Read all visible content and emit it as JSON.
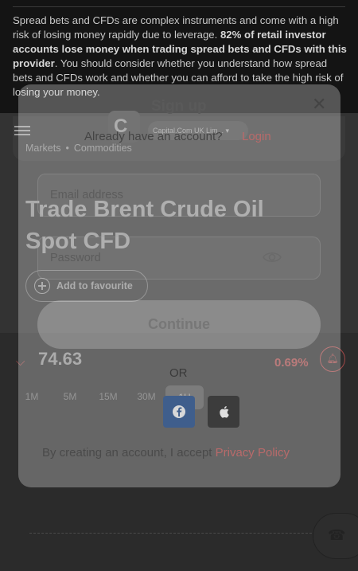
{
  "risk_warning": {
    "text_start": "Spread bets and CFDs are complex instruments and come with a high risk of losing money rapidly due to leverage. ",
    "text_bold": "82% of retail investor accounts lose money when trading spread bets and CFDs with this provider",
    "text_end": ". You should consider whether you understand how spread bets and CFDs work and whether you can afford to take the high risk of losing your money."
  },
  "header": {
    "logo_letter": "C",
    "entity_label": "Capital.Com UK Lim...",
    "icons": {
      "menu": "menu-icon",
      "dropdown": "chevron-down-icon"
    }
  },
  "breadcrumb": [
    "Markets",
    "Commodities"
  ],
  "instrument": {
    "title": "Trade Brent Crude Oil Spot CFD",
    "favourite_label": "Add to favourite",
    "price": "74.63",
    "change": "0.69%",
    "timeframes": [
      "1M",
      "5M",
      "15M",
      "30M",
      "1H"
    ],
    "active_timeframe": "1H"
  },
  "modal": {
    "title": "Sign up",
    "have_account": "Already have an account?",
    "login_link": "Login",
    "email_placeholder": "Email address",
    "password_placeholder": "Password",
    "continue_label": "Continue",
    "or_label": "OR",
    "terms_text": "By creating an account, I accept ",
    "privacy_link": "Privacy Policy"
  },
  "colors": {
    "accent_red": "#b96a6a",
    "negative": "#a14848",
    "facebook": "#3f5e8c"
  }
}
